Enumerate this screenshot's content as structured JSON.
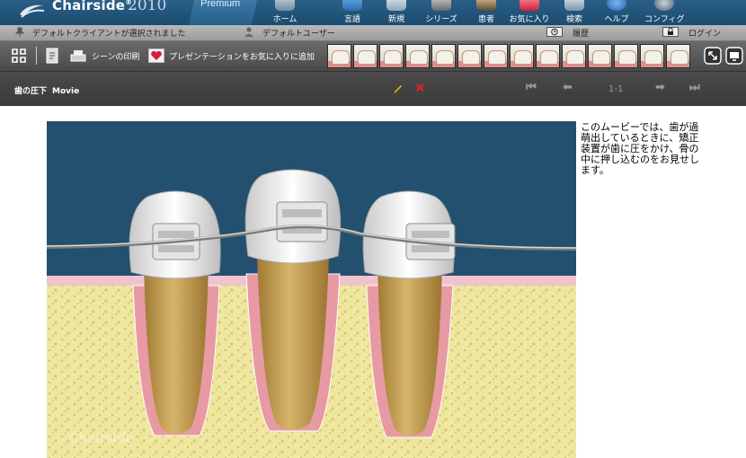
{
  "app": {
    "name": "Chairside",
    "year": "2010",
    "edition": "Premium"
  },
  "nav": [
    {
      "label": "ホーム",
      "icon": "tooth-home-icon"
    },
    {
      "label": "言語",
      "icon": "globe-language-icon"
    },
    {
      "label": "新規",
      "icon": "new-document-icon"
    },
    {
      "label": "シリーズ",
      "icon": "film-series-icon"
    },
    {
      "label": "患者",
      "icon": "patient-icon"
    },
    {
      "label": "お気に入り",
      "icon": "favorites-heart-icon"
    },
    {
      "label": "検索",
      "icon": "search-icon"
    },
    {
      "label": "ヘルプ",
      "icon": "help-icon"
    },
    {
      "label": "コンフィグ",
      "icon": "config-gear-icon"
    }
  ],
  "status": {
    "client": "デフォルトクライアントが選択されました",
    "user": "デフォルトユーザー",
    "history": "履歴",
    "login": "ログイン"
  },
  "toolbar": {
    "print_scene": "シーンの印刷",
    "add_favorite": "プレゼンテーションをお気に入りに追加",
    "thumbnail_count": 14
  },
  "header": {
    "title": "歯の圧下",
    "type": "Movie",
    "pagination": "1-1"
  },
  "description": "このムービーでは、歯が過萌出しているときに、矯正装置が歯に圧をかけ、骨の中に押し込むのをお見せします。",
  "watermark": "Chairside",
  "colors": {
    "topbar": "#1f4f76",
    "toolbar": "#5a5a5a",
    "header": "#444444",
    "video_bg": "#24506f",
    "bone": "#efe6a0",
    "gum": "#e7a1a7",
    "root": "#c9a155"
  }
}
